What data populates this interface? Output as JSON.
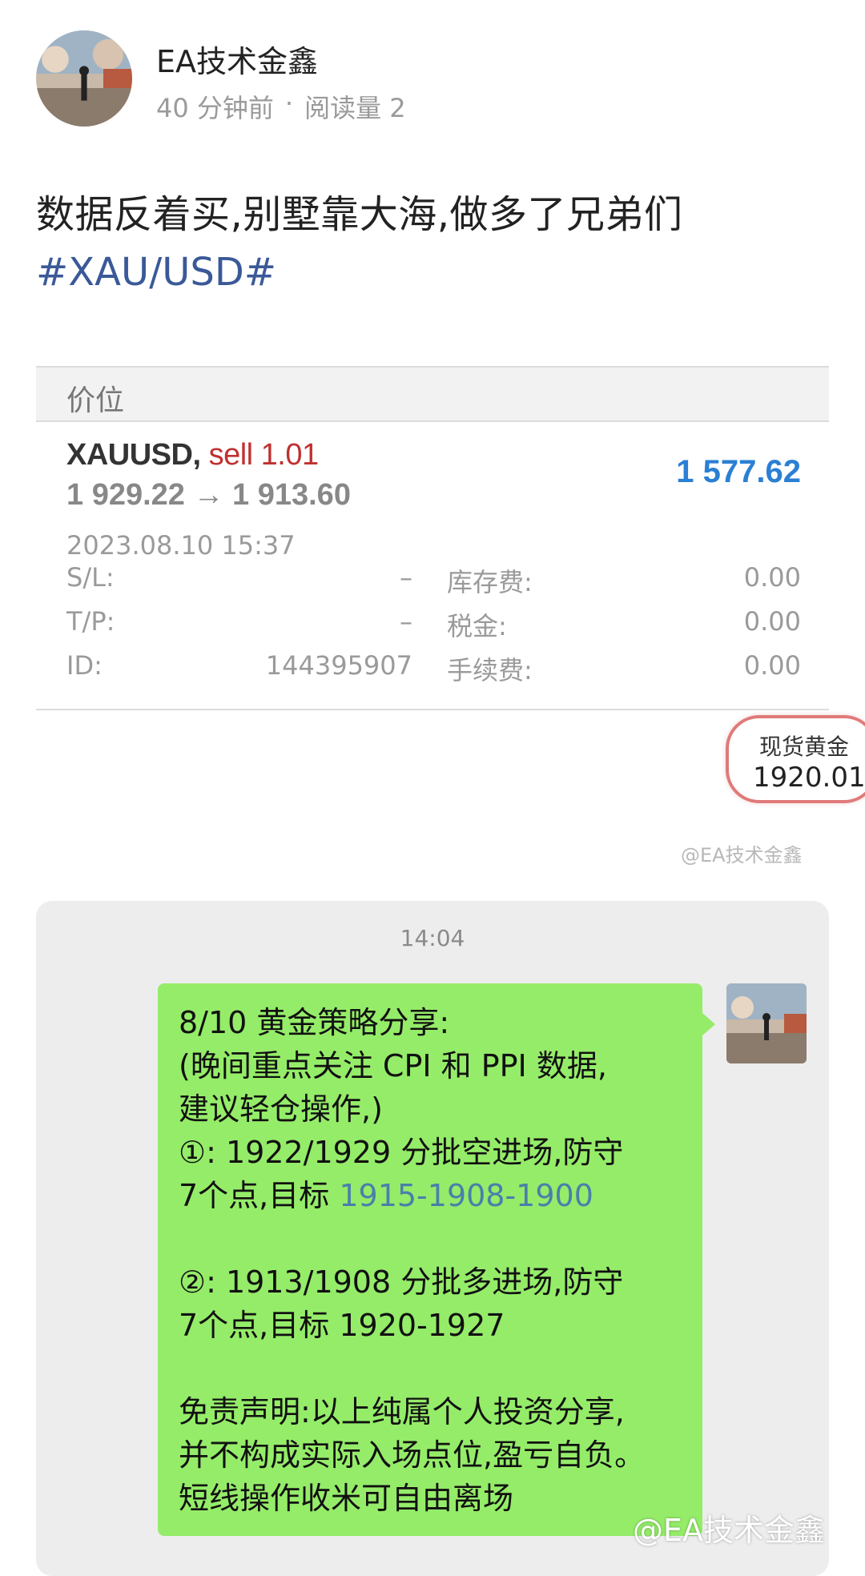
{
  "author": {
    "name": "EA技术金鑫",
    "time_ago": "40 分钟前",
    "separator": "·",
    "reads": "阅读量 2"
  },
  "post": {
    "text": "数据反着买,别墅靠大海,做多了兄弟们",
    "hashtag": "#XAU/USD#"
  },
  "trade": {
    "header": "价位",
    "symbol": "XAUUSD,",
    "side": "sell 1.01",
    "prices": "1 929.22 → 1 913.60",
    "profit": "1 577.62",
    "time": "2023.08.10 15:37",
    "rows": [
      {
        "k1": "S/L:",
        "v1": "–",
        "k2": "库存费:",
        "v2": "0.00"
      },
      {
        "k1": "T/P:",
        "v1": "–",
        "k2": "税金:",
        "v2": "0.00"
      },
      {
        "k1": "ID:",
        "v1": "144395907",
        "k2": "手续费:",
        "v2": "0.00"
      }
    ]
  },
  "spot_gold": {
    "label": "现货黄金",
    "value": "1920.01"
  },
  "watermark": "@EA技术金鑫",
  "chat": {
    "time": "14:04",
    "lines": {
      "l1": "8/10 黄金策略分享:",
      "l2": "(晚间重点关注 CPI 和 PPI 数据,",
      "l3": "建议轻仓操作,)",
      "l4": "①: 1922/1929 分批空进场,防守",
      "l5_prefix": "7个点,目标 ",
      "l5_link": "1915-1908-1900",
      "l6": "②: 1913/1908 分批多进场,防守",
      "l7": "7个点,目标 1920-1927",
      "l8": "免责声明:以上纯属个人投资分享,",
      "l9": "并不构成实际入场点位,盈亏自负。",
      "l10": "短线操作收米可自由离场"
    }
  },
  "icons": {
    "avatar": "avatar-image",
    "chat_avatar": "chat-avatar-image"
  },
  "colors": {
    "hashtag": "#3b5998",
    "sell": "#c03030",
    "profit": "#2b7fd4",
    "bubble": "#95ec69",
    "badge_border": "#e07a7a"
  }
}
